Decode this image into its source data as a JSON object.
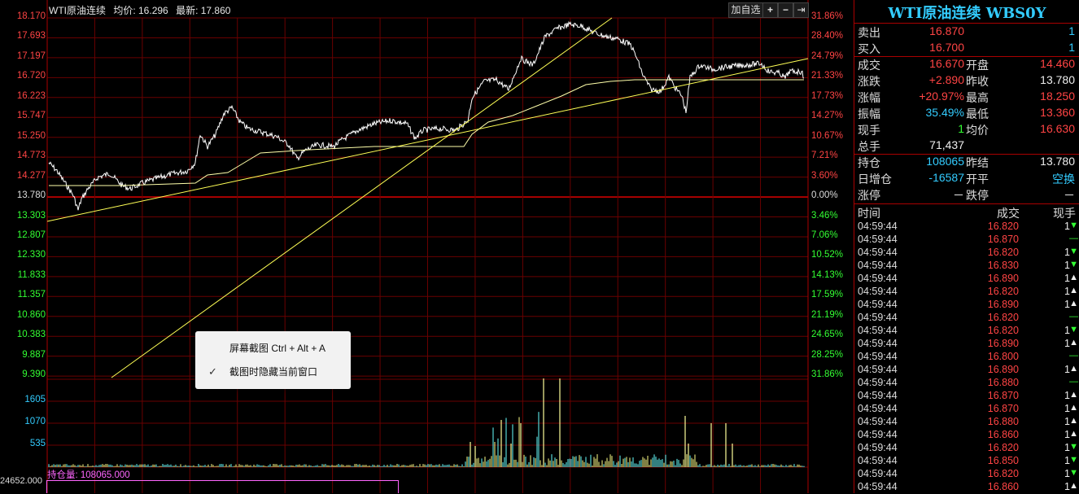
{
  "header": {
    "name": "WTI原油连续",
    "avg_label": "均价: 16.296",
    "last_label": "最新: 17.860"
  },
  "toolbar": {
    "add_fav": "加自选",
    "plus": "+",
    "minus": "−",
    "end": "⇥"
  },
  "price_axis": [
    "18.170",
    "17.693",
    "17.197",
    "16.720",
    "16.223",
    "15.747",
    "15.250",
    "14.773",
    "14.277",
    "13.780",
    "13.303",
    "12.807",
    "12.330",
    "11.833",
    "11.357",
    "10.860",
    "10.383",
    "9.887",
    "9.390"
  ],
  "pct_axis": [
    "31.86%",
    "28.40%",
    "24.79%",
    "21.33%",
    "17.73%",
    "14.27%",
    "10.67%",
    "7.21%",
    "3.60%",
    "0.00%",
    "3.46%",
    "7.06%",
    "10.52%",
    "14.13%",
    "17.59%",
    "21.19%",
    "24.65%",
    "28.25%",
    "31.86%"
  ],
  "volume_axis": [
    "1605",
    "1070",
    "535"
  ],
  "open_interest": {
    "label": "持仓量: 108065.000",
    "left_value": "24652.000"
  },
  "context_menu": {
    "item1": "屏幕截图 Ctrl + Alt + A",
    "item2": "截图时隐藏当前窗口",
    "check": "✓"
  },
  "panel": {
    "title": "WTI原油连续 WBS0Y",
    "ask": {
      "label": "卖出",
      "price": "16.870",
      "vol": "1"
    },
    "bid": {
      "label": "买入",
      "price": "16.700",
      "vol": "1"
    },
    "stats": [
      {
        "l1": "成交",
        "v1": "16.670",
        "l2": "开盘",
        "v2": "14.460",
        "c1": "red",
        "c2": "red"
      },
      {
        "l1": "涨跌",
        "v1": "+2.890",
        "l2": "昨收",
        "v2": "13.780",
        "c1": "red",
        "c2": "wht"
      },
      {
        "l1": "涨幅",
        "v1": "+20.97%",
        "l2": "最高",
        "v2": "18.250",
        "c1": "red",
        "c2": "red"
      },
      {
        "l1": "振幅",
        "v1": "35.49%",
        "l2": "最低",
        "v2": "13.360",
        "c1": "cyan",
        "c2": "red"
      },
      {
        "l1": "现手",
        "v1": "1",
        "l2": "均价",
        "v2": "16.630",
        "c1": "grn",
        "c2": "red"
      },
      {
        "l1": "总手",
        "v1": "71,437",
        "l2": "",
        "v2": "",
        "c1": "wht",
        "c2": "wht"
      }
    ],
    "oi_rows": [
      {
        "l1": "持仓",
        "v1": "108065",
        "l2": "昨结",
        "v2": "13.780",
        "c1": "cyan",
        "c2": "wht"
      },
      {
        "l1": "日增仓",
        "v1": "-16587",
        "l2": "开平",
        "v2": "空换",
        "c1": "cyan",
        "c2": "cyan"
      },
      {
        "l1": "涨停",
        "v1": "－",
        "l2": "跌停",
        "v2": "－",
        "c1": "wht",
        "c2": "wht"
      }
    ],
    "tick_header": {
      "time": "时间",
      "price": "成交",
      "vol": "现手"
    },
    "ticks": [
      {
        "t": "04:59:44",
        "p": "16.820",
        "v": "1",
        "d": "down"
      },
      {
        "t": "04:59:44",
        "p": "16.870",
        "v": "",
        "d": "flat"
      },
      {
        "t": "04:59:44",
        "p": "16.820",
        "v": "1",
        "d": "down"
      },
      {
        "t": "04:59:44",
        "p": "16.830",
        "v": "1",
        "d": "down"
      },
      {
        "t": "04:59:44",
        "p": "16.890",
        "v": "1",
        "d": "up"
      },
      {
        "t": "04:59:44",
        "p": "16.820",
        "v": "1",
        "d": "up"
      },
      {
        "t": "04:59:44",
        "p": "16.890",
        "v": "1",
        "d": "up"
      },
      {
        "t": "04:59:44",
        "p": "16.820",
        "v": "",
        "d": "flat"
      },
      {
        "t": "04:59:44",
        "p": "16.820",
        "v": "1",
        "d": "down"
      },
      {
        "t": "04:59:44",
        "p": "16.890",
        "v": "1",
        "d": "up"
      },
      {
        "t": "04:59:44",
        "p": "16.800",
        "v": "",
        "d": "flat"
      },
      {
        "t": "04:59:44",
        "p": "16.890",
        "v": "1",
        "d": "up"
      },
      {
        "t": "04:59:44",
        "p": "16.880",
        "v": "",
        "d": "flat"
      },
      {
        "t": "04:59:44",
        "p": "16.870",
        "v": "1",
        "d": "up"
      },
      {
        "t": "04:59:44",
        "p": "16.870",
        "v": "1",
        "d": "up"
      },
      {
        "t": "04:59:44",
        "p": "16.880",
        "v": "1",
        "d": "up"
      },
      {
        "t": "04:59:44",
        "p": "16.860",
        "v": "1",
        "d": "up"
      },
      {
        "t": "04:59:44",
        "p": "16.820",
        "v": "1",
        "d": "down"
      },
      {
        "t": "04:59:44",
        "p": "16.850",
        "v": "1",
        "d": "down"
      },
      {
        "t": "04:59:44",
        "p": "16.820",
        "v": "1",
        "d": "down"
      },
      {
        "t": "04:59:44",
        "p": "16.860",
        "v": "1",
        "d": "up"
      }
    ]
  },
  "colors": {
    "up": "#ff4444",
    "down": "#33ff33",
    "grid": "#880000",
    "accent": "#33ccff"
  }
}
